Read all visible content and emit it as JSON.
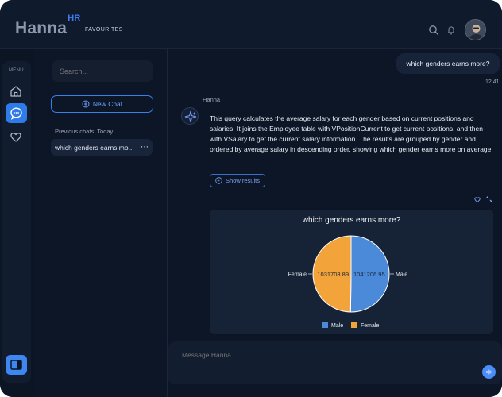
{
  "brand": {
    "name": "Hanna",
    "suffix": "HR"
  },
  "header": {
    "favourites_label": "FAVOURITES",
    "search_icon": "search-icon",
    "bell_icon": "bell-icon"
  },
  "sidebar_rail": {
    "menu_label": "MENU",
    "icons": [
      "home-icon",
      "chat-icon",
      "heart-icon"
    ]
  },
  "side_panel": {
    "search_placeholder": "Search...",
    "new_chat_label": "New Chat",
    "previous_title": "Previous chats: Today",
    "previous_items": [
      {
        "label": "which genders earns mo...",
        "menu": "⋯"
      }
    ]
  },
  "chat": {
    "user_message": "which genders earns more?",
    "time": "12:41",
    "bot_name": "Hanna",
    "answer": "This query calculates the average salary for each gender based on current positions and salaries. It joins the Employee table with VPositionCurrent to get current positions, and then with VSalary to get the current salary information. The results are grouped by gender and ordered by average salary in descending order, showing which gender earns more on average.",
    "show_results_label": "Show results"
  },
  "chart_data": {
    "type": "pie",
    "title": "which genders earns more?",
    "slices": [
      {
        "label": "Male",
        "value": 1041206.95,
        "color": "#4a8ad8"
      },
      {
        "label": "Female",
        "value": 1031703.89,
        "color": "#f2a33a"
      }
    ],
    "legend": [
      "Male",
      "Female"
    ],
    "legend_position": "bottom"
  },
  "composer": {
    "placeholder": "Message Hanna"
  },
  "colors": {
    "accent": "#2f7be8",
    "background": "#0d1626",
    "panel": "#162235"
  }
}
